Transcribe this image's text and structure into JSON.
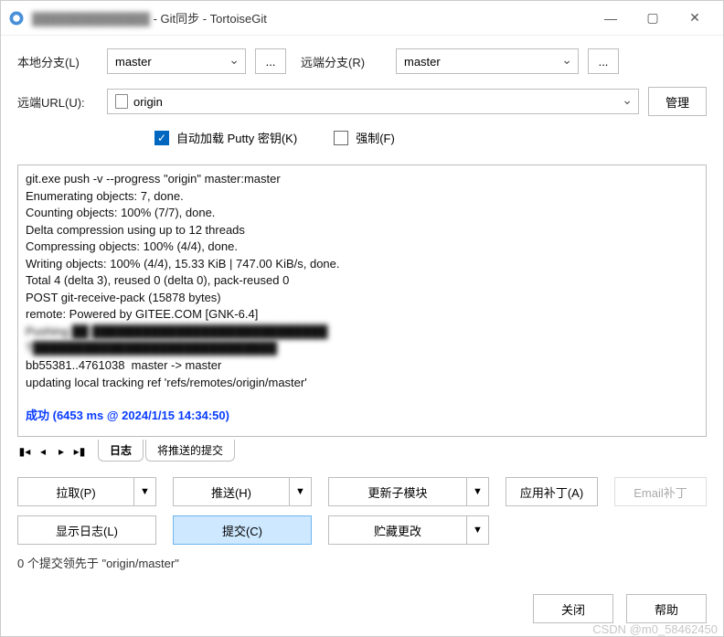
{
  "window": {
    "title_suffix": "- Git同步 - TortoiseGit",
    "title_blurred": "██████████████"
  },
  "form": {
    "local_branch_label": "本地分支(L)",
    "local_branch_value": "master",
    "browse1": "...",
    "remote_branch_label": "远端分支(R)",
    "remote_branch_value": "master",
    "browse2": "...",
    "remote_url_label": "远端URL(U):",
    "remote_url_value": "origin",
    "manage_button": "管理",
    "autoload_putty_label": "自动加载 Putty 密钥(K)",
    "autoload_putty_checked": true,
    "force_label": "强制(F)",
    "force_checked": false
  },
  "log": {
    "lines": [
      "git.exe push -v --progress \"origin\" master:master",
      "Enumerating objects: 7, done.",
      "Counting objects: 100% (7/7), done.",
      "Delta compression using up to 12 threads",
      "Compressing objects: 100% (4/4), done.",
      "Writing objects: 100% (4/4), 15.33 KiB | 747.00 KiB/s, done.",
      "Total 4 (delta 3), reused 0 (delta 0), pack-reused 0",
      "POST git-receive-pack (15878 bytes)",
      "remote: Powered by GITEE.COM [GNK-6.4]"
    ],
    "blurred1": "Pushing ██ ████████████████████████████",
    "blurred2": "T█████████████████████████████",
    "line_ref": "bb55381..4761038  master -> master",
    "line_update": "updating local tracking ref 'refs/remotes/origin/master'",
    "success": "成功 (6453 ms @ 2024/1/15 14:34:50)"
  },
  "tabs": {
    "active": "日志",
    "other": "将推送的提交"
  },
  "actions": {
    "pull": "拉取(P)",
    "push": "推送(H)",
    "update_submodule": "更新子模块",
    "apply_patch": "应用补丁(A)",
    "email_patch": "Email补丁",
    "show_log": "显示日志(L)",
    "commit": "提交(C)",
    "stash": "贮藏更改"
  },
  "status": "0 个提交领先于 \"origin/master\"",
  "footer": {
    "close": "关闭",
    "help": "帮助"
  },
  "watermark": "CSDN @m0_58462450"
}
